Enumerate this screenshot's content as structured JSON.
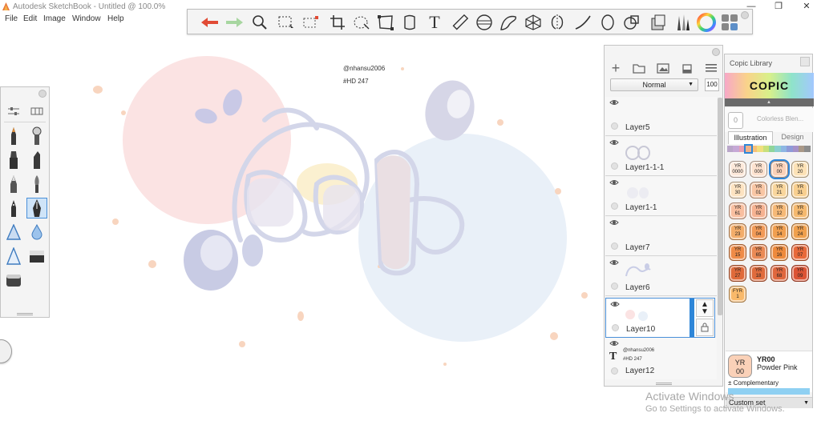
{
  "window": {
    "title": "Autodesk SketchBook - Untitled @ 100.0%",
    "controls": [
      "—",
      "❐",
      "✕"
    ]
  },
  "menu": [
    "File",
    "Edit",
    "Image",
    "Window",
    "Help"
  ],
  "canvas_text": {
    "handle": "@nhansu2006",
    "tag": "#HD 247"
  },
  "top_toolbar": {
    "tools": [
      "undo-icon",
      "redo-icon",
      "zoom-icon",
      "select-icon",
      "transform-select-icon",
      "crop-icon",
      "lasso-icon",
      "distort-icon",
      "perspective-icon",
      "text-icon",
      "ruler-icon",
      "ellipse-guide-icon",
      "french-curve-icon",
      "perspective-grid-icon",
      "symmetry-icon",
      "stroke-icon",
      "shape-icon",
      "fill-icon",
      "copic-library-icon",
      "brush-library-icon",
      "color-wheel-icon",
      "layers-toggle-icon"
    ]
  },
  "layers": {
    "blend_mode": "Normal",
    "opacity": "100",
    "items": [
      {
        "name": "Layer5"
      },
      {
        "name": "Layer1-1-1"
      },
      {
        "name": "Layer1-1"
      },
      {
        "name": "Layer7"
      },
      {
        "name": "Layer6"
      },
      {
        "name": "Layer10",
        "selected": true
      },
      {
        "name": "Layer12",
        "text_lines": [
          "@nhansu2006",
          "#HD 247"
        ]
      }
    ]
  },
  "copic": {
    "title": "Copic Library",
    "brand": "COPIC",
    "colorless_code": "0",
    "colorless_label": "Colorless Blen...",
    "tabs": [
      "Illustration",
      "Design"
    ],
    "swatches": [
      {
        "line1": "YR",
        "line2": "0000",
        "color": "#fde9da"
      },
      {
        "line1": "YR",
        "line2": "000",
        "color": "#fde2cf"
      },
      {
        "line1": "YR",
        "line2": "00",
        "color": "#fad1b8",
        "selected": true
      },
      {
        "line1": "YR",
        "line2": "20",
        "color": "#fce2b6"
      },
      {
        "line1": "YR",
        "line2": "30",
        "color": "#fde3c1"
      },
      {
        "line1": "YR",
        "line2": "01",
        "color": "#f9c6a4"
      },
      {
        "line1": "YR",
        "line2": "21",
        "color": "#f9d69c"
      },
      {
        "line1": "YR",
        "line2": "31",
        "color": "#f8cf8f"
      },
      {
        "line1": "YR",
        "line2": "61",
        "color": "#f9bfa0"
      },
      {
        "line1": "YR",
        "line2": "02",
        "color": "#f6b291"
      },
      {
        "line1": "YR",
        "line2": "12",
        "color": "#f6b977"
      },
      {
        "line1": "YR",
        "line2": "82",
        "color": "#f5b96e"
      },
      {
        "line1": "YR",
        "line2": "23",
        "color": "#f3ad6a"
      },
      {
        "line1": "YR",
        "line2": "04",
        "color": "#f29a57"
      },
      {
        "line1": "YR",
        "line2": "14",
        "color": "#f19f4f"
      },
      {
        "line1": "YR",
        "line2": "24",
        "color": "#f0a04d"
      },
      {
        "line1": "YR",
        "line2": "15",
        "color": "#ef8b47"
      },
      {
        "line1": "YR",
        "line2": "65",
        "color": "#ea8a55"
      },
      {
        "line1": "YR",
        "line2": "16",
        "color": "#ee8a3c"
      },
      {
        "line1": "YR",
        "line2": "07",
        "color": "#e8693a"
      },
      {
        "line1": "YR",
        "line2": "27",
        "color": "#e06a3a"
      },
      {
        "line1": "YR",
        "line2": "18",
        "color": "#e06b3c"
      },
      {
        "line1": "YR",
        "line2": "68",
        "color": "#e0673e"
      },
      {
        "line1": "YR",
        "line2": "09",
        "color": "#dc5334"
      },
      {
        "line1": "FYR",
        "line2": "1",
        "color": "#f9b96a"
      }
    ],
    "strip_colors": [
      "#b9a6c9",
      "#c6a8d6",
      "#e7a0b6",
      "#f0b28a",
      "#f7c079",
      "#f1df7e",
      "#c8e07b",
      "#8fd59a",
      "#8bcfd0",
      "#8db6e3",
      "#8e9ad8",
      "#a591c8",
      "#a99887",
      "#8c8c8c"
    ],
    "current": {
      "line1": "YR",
      "line2": "00",
      "code": "YR00",
      "name": "Powder Pink",
      "complementary": "± Complementary"
    },
    "set": "Custom set"
  },
  "watermark": {
    "line1": "Activate Windows",
    "line2": "Go to Settings to activate Windows."
  }
}
